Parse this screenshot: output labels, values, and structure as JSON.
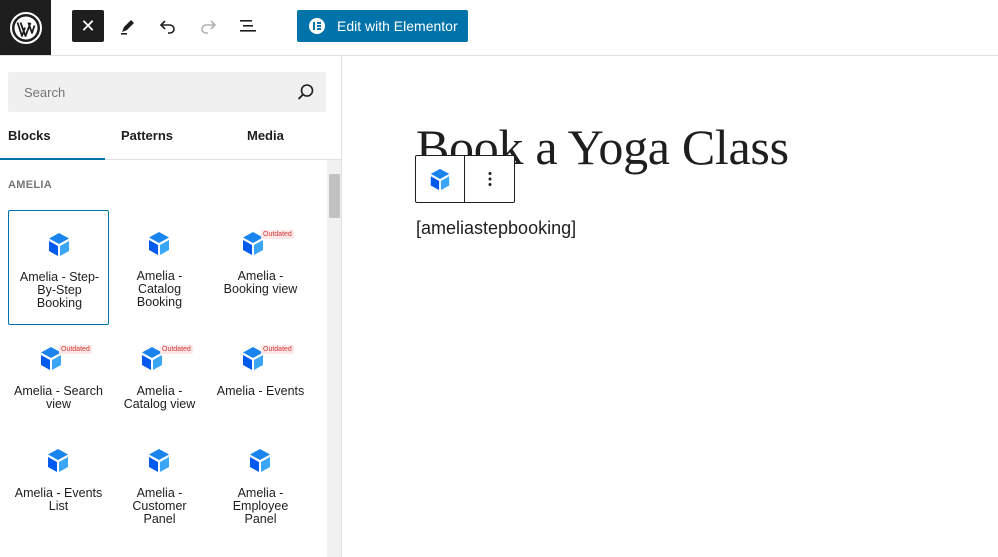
{
  "toolbar": {
    "wp_logo_icon": "wordpress-logo-icon",
    "close_icon": "close-icon",
    "close_glyph": "✕",
    "edit_icon": "pencil-icon",
    "undo_icon": "undo-icon",
    "redo_icon": "redo-icon",
    "list_view_icon": "list-view-icon",
    "elementor_label": "Edit with Elementor",
    "elementor_icon": "elementor-icon",
    "accent_color": "#0073aa"
  },
  "inserter": {
    "search": {
      "placeholder": "Search",
      "value": "",
      "icon": "search-icon"
    },
    "tabs": [
      {
        "label": "Blocks",
        "active": true
      },
      {
        "label": "Patterns",
        "active": false
      },
      {
        "label": "Media",
        "active": false
      }
    ],
    "category": "AMELIA",
    "blocks": [
      {
        "label": "Amelia - Step-By-Step Booking",
        "selected": true,
        "outdated": false
      },
      {
        "label": "Amelia - Catalog Booking",
        "selected": false,
        "outdated": false
      },
      {
        "label": "Amelia - Booking view",
        "selected": false,
        "outdated": true
      },
      {
        "label": "Amelia - Search view",
        "selected": false,
        "outdated": true
      },
      {
        "label": "Amelia - Catalog view",
        "selected": false,
        "outdated": true
      },
      {
        "label": "Amelia - Events",
        "selected": false,
        "outdated": true
      },
      {
        "label": "Amelia - Events List",
        "selected": false,
        "outdated": false
      },
      {
        "label": "Amelia - Customer Panel",
        "selected": false,
        "outdated": false
      },
      {
        "label": "Amelia - Employee Panel",
        "selected": false,
        "outdated": false
      }
    ],
    "outdated_badge": "Outdated",
    "block_icon": "amelia-cube-icon"
  },
  "editor": {
    "title": "Book a Yoga Class",
    "block_toolbar_icon": "amelia-cube-icon",
    "block_more_icon": "more-vertical-icon",
    "shortcode": "[ameliastepbooking]"
  }
}
